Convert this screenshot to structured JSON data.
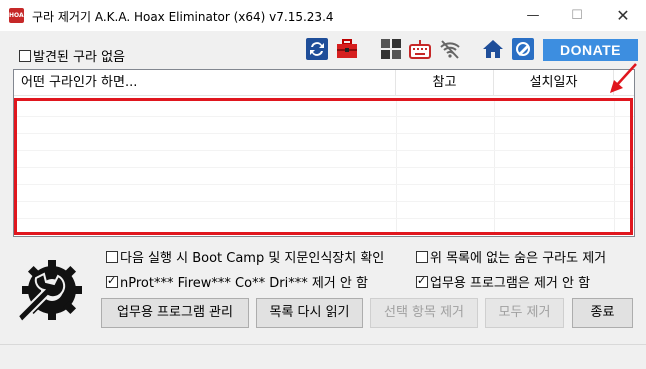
{
  "window": {
    "title": "구라 제거기 A.K.A. Hoax Eliminator (x64) v7.15.23.4",
    "app_icon_text": "HOAX",
    "minimize": "—",
    "maximize": "☐",
    "close": "✕"
  },
  "toolbar": {
    "hide_found_label": "발견된 구라 없음",
    "donate_label": "DONATE",
    "icons": [
      "refresh-icon",
      "toolbox-icon",
      "windows-icon",
      "keyboard-icon",
      "wifi-off-icon",
      "home-icon",
      "settings-icon"
    ]
  },
  "list": {
    "columns": [
      "어떤 구라인가 하면...",
      "참고",
      "설치일자"
    ],
    "rows": []
  },
  "options": {
    "boot_camp_label": "다음 실행 시 Boot Camp 및 지문인식장치 확인",
    "boot_camp_checked": false,
    "hidden_items_label": "위 목록에 없는 숨은 구라도 제거",
    "hidden_items_checked": false,
    "nprotect_label": "nProt*** Firew*** Co** Dri*** 제거 안 함",
    "nprotect_checked": true,
    "business_label": "업무용 프로그램은 제거 안 함",
    "business_checked": true
  },
  "buttons": {
    "manage_business": "업무용 프로그램 관리",
    "reload_list": "목록 다시 읽기",
    "remove_selected": "선택 항목 제거",
    "remove_all": "모두 제거",
    "exit": "종료"
  },
  "colors": {
    "accent": "#3d8ee0",
    "highlight": "#e0161e"
  }
}
